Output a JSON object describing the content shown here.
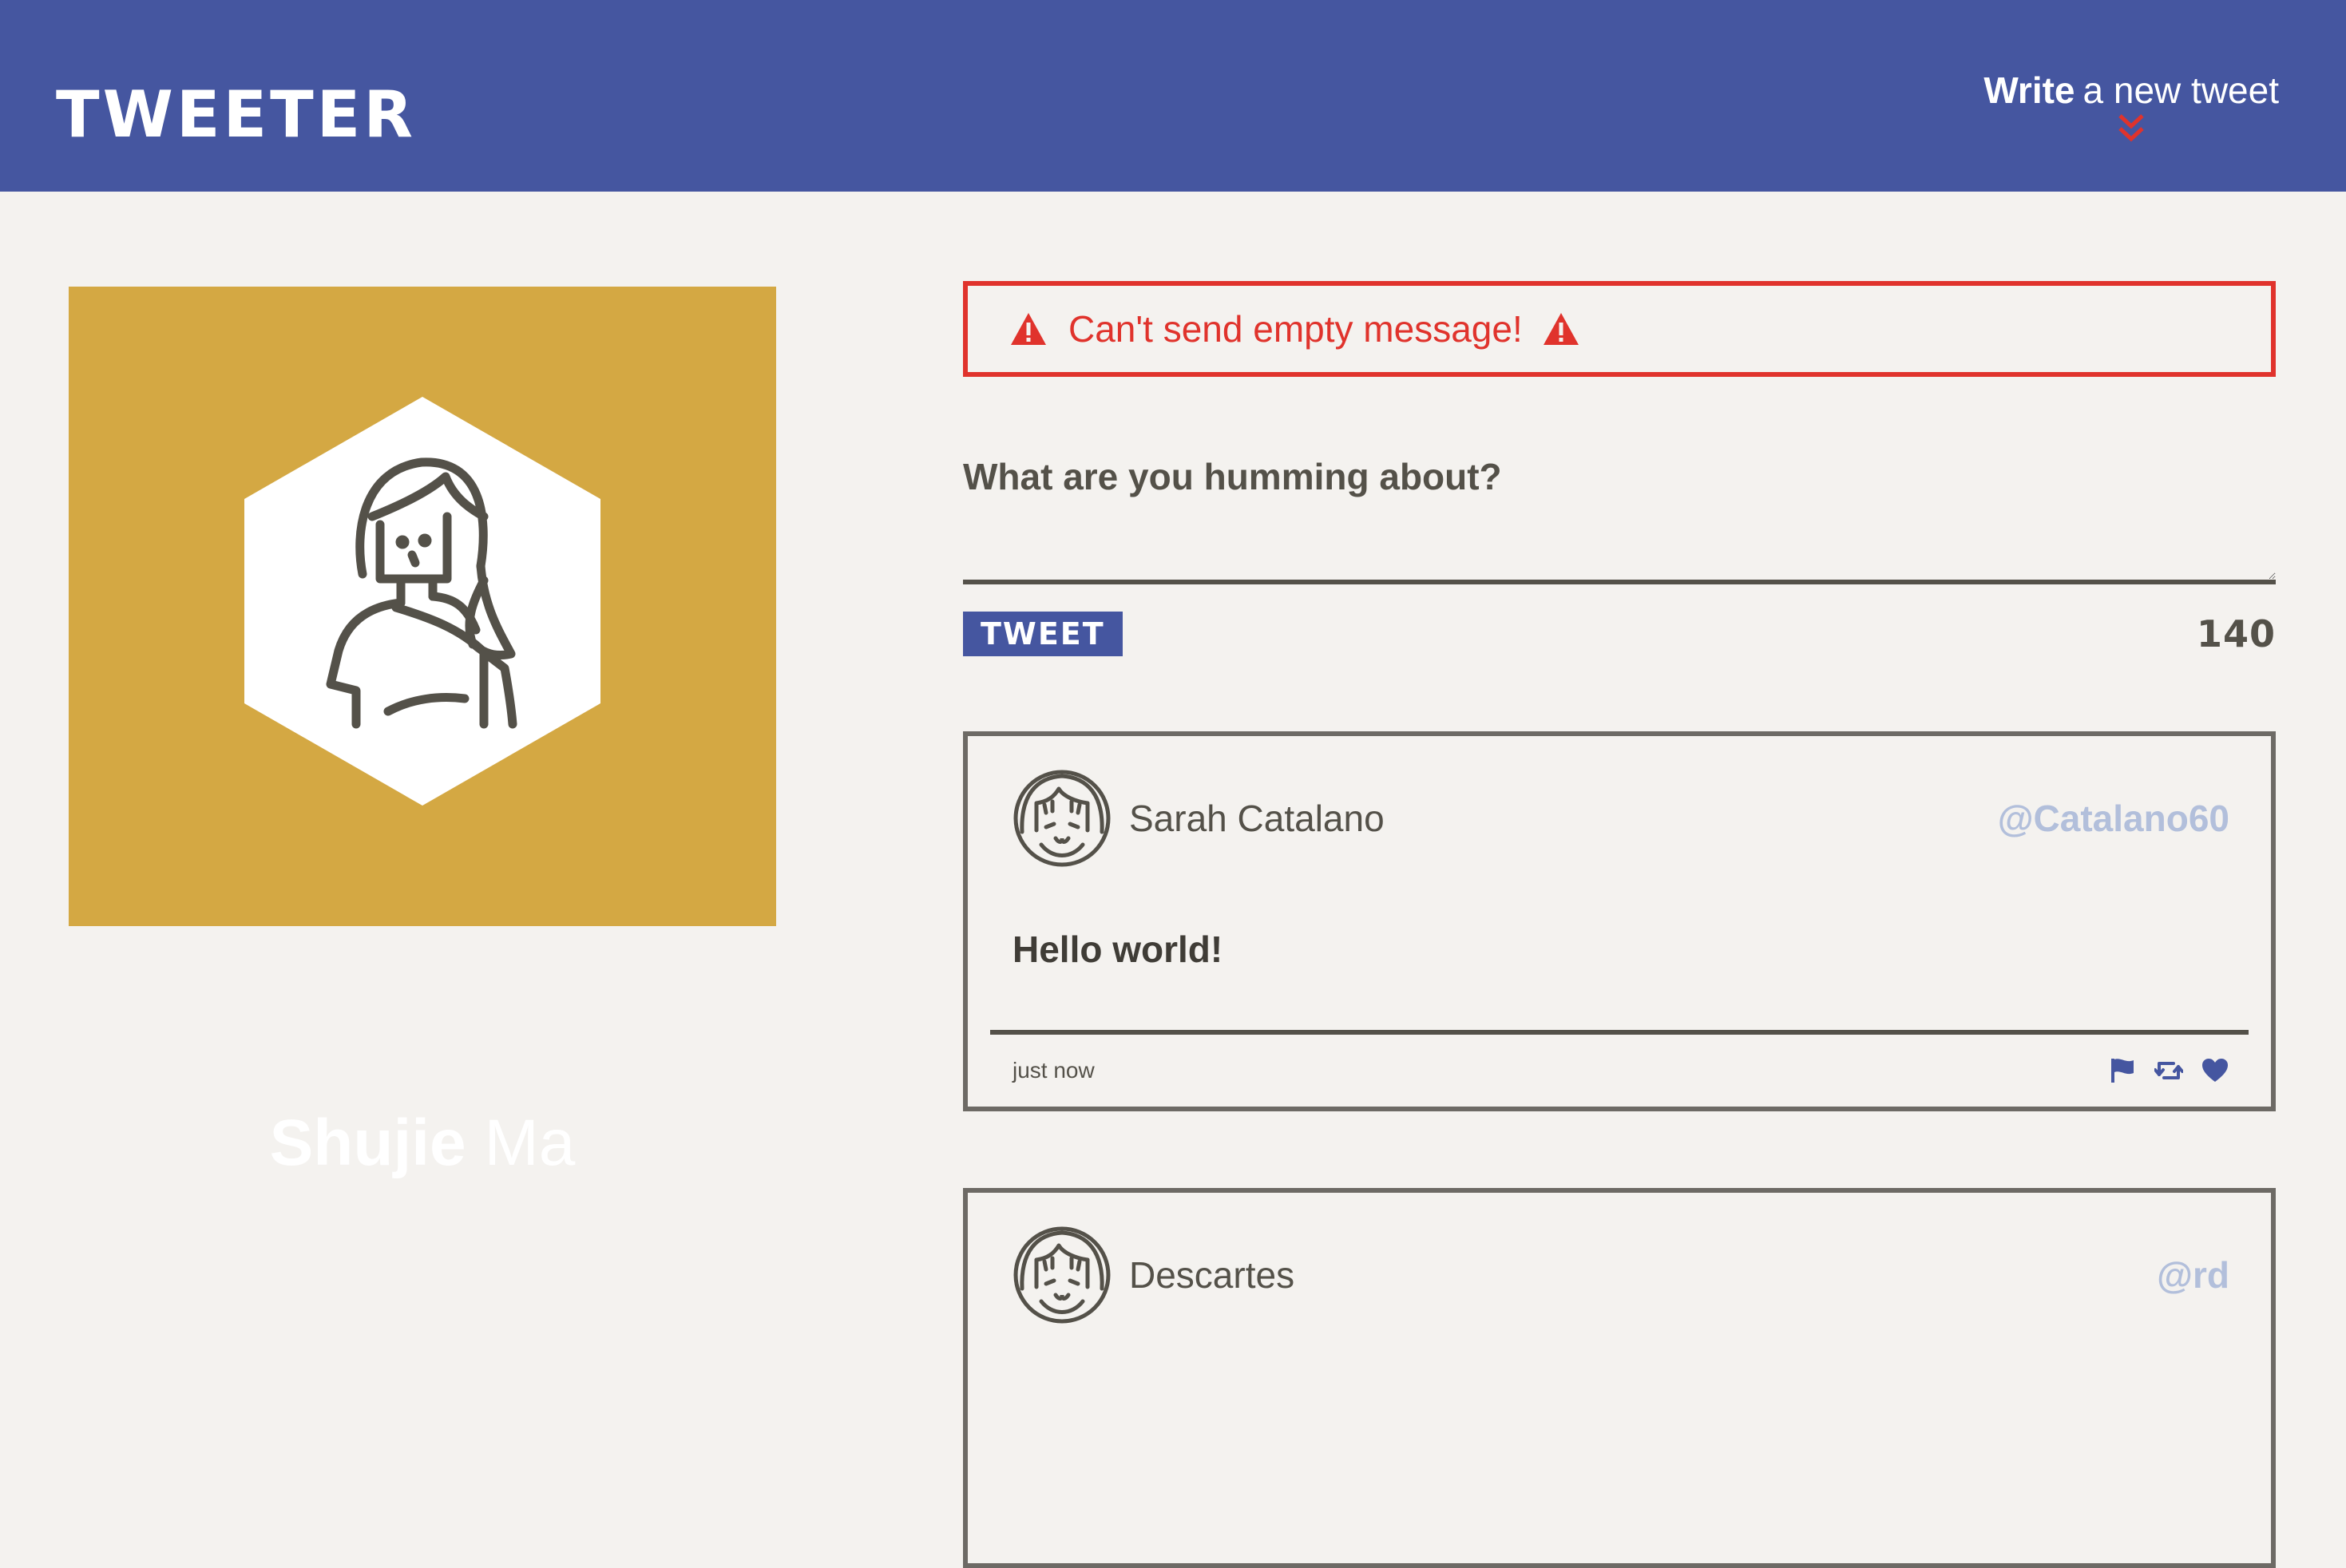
{
  "nav": {
    "brand": "TWEETER",
    "compose_bold": "Write",
    "compose_rest": "a new tweet",
    "chevron_icon": "double-chevron-down-icon",
    "colors": {
      "background": "#4556a0",
      "chevron": "#e0332c"
    }
  },
  "profile": {
    "first_name": "Shujie",
    "last_name": "Ma",
    "background_color": "#d4a843",
    "avatar_icon": "woman-avatar-icon"
  },
  "composer": {
    "error_message": "Can't send empty message!",
    "warning_icon": "warning-icon",
    "prompt_label": "What are you humming about?",
    "textarea_value": "",
    "tweet_button": "TWEET",
    "char_counter": "140",
    "colors": {
      "error": "#e0332c",
      "button": "#4556a0"
    }
  },
  "tweets": [
    {
      "name": "Sarah Catalano",
      "handle": "@Catalano60",
      "body": "Hello world!",
      "time": "just now",
      "avatar_icon": "smiling-girl-avatar-icon",
      "actions": [
        "flag-icon",
        "retweet-icon",
        "heart-icon"
      ]
    },
    {
      "name": "Descartes",
      "handle": "@rd",
      "avatar_icon": "smiling-girl-avatar-icon"
    }
  ]
}
